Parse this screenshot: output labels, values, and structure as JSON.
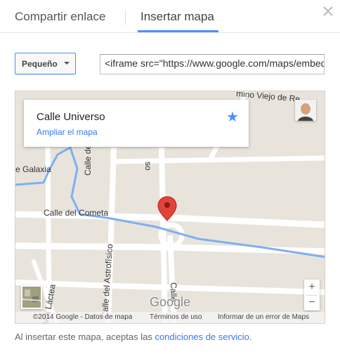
{
  "tabs": {
    "share_link": "Compartir enlace",
    "embed_map": "Insertar mapa",
    "active_color": "#4d90fe"
  },
  "close_icon": "close-icon",
  "size_select": {
    "selected": "Pequeño"
  },
  "embed_code": {
    "value": "<iframe src=\"https://www.google.com/maps/embed?pb="
  },
  "map": {
    "place_name": "Calle Universo",
    "enlarge_link": "Ampliar el mapa",
    "star_icon": "star-icon",
    "streets": {
      "galaxia": "e Galaxia",
      "cometa": "Calle del Cometa",
      "astrofisico": "Calle del Astrofísico",
      "lactea": "Vía Láctea",
      "camino": "mino Viejo de Re",
      "c_vertical": "Calle de la C",
      "so": "so",
      "calle_bottom": "Calle"
    },
    "zoom_in": "+",
    "zoom_out": "−",
    "google_logo": "Google",
    "attribution": {
      "copyright": "©2014 Google - Datos de mapa",
      "terms": "Términos de uso",
      "report": "Informar de un error de Maps"
    }
  },
  "footer": {
    "prefix": "Al insertar este mapa, aceptas las ",
    "link": "condiciones de servicio",
    "suffix": "."
  }
}
